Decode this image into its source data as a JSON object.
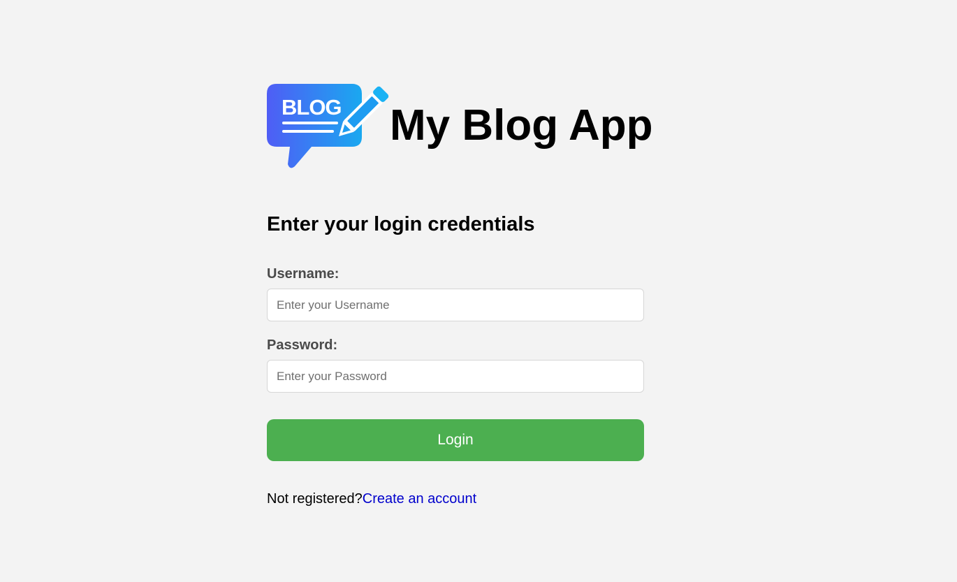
{
  "header": {
    "logo_icon": "blog-logo-icon",
    "logo_text": "BLOG",
    "title": "My Blog App"
  },
  "form": {
    "heading": "Enter your login credentials",
    "username": {
      "label": "Username:",
      "value": "",
      "placeholder": "Enter your Username"
    },
    "password": {
      "label": "Password:",
      "value": "",
      "placeholder": "Enter your Password"
    },
    "submit_label": "Login"
  },
  "register": {
    "prompt": "Not registered?",
    "link_text": "Create an account"
  },
  "colors": {
    "background": "#f3f3f3",
    "primary_button": "#4caf50",
    "link": "#0000cc",
    "label": "#4a4a4a",
    "logo_gradient_start": "#4f5df5",
    "logo_gradient_end": "#1aa8f0"
  }
}
